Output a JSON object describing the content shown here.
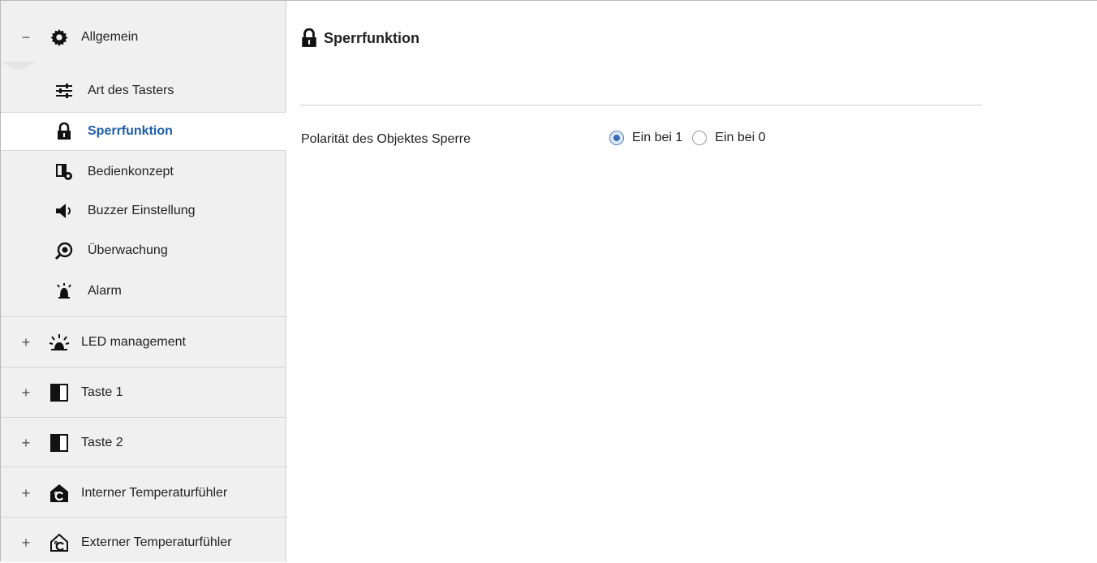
{
  "sidebar": {
    "groups": [
      {
        "toggle": "−",
        "icon": "gear-icon",
        "label": "Allgemein"
      },
      {
        "toggle": "+",
        "icon": "led-rays-icon",
        "label": "LED management"
      },
      {
        "toggle": "+",
        "icon": "half-square-icon",
        "label": "Taste 1"
      },
      {
        "toggle": "+",
        "icon": "half-square-icon",
        "label": "Taste 2"
      },
      {
        "toggle": "+",
        "icon": "house-thermometer-filled-icon",
        "label": "Interner Temperaturfühler"
      },
      {
        "toggle": "+",
        "icon": "house-thermometer-outline-icon",
        "label": "Externer Temperaturfühler"
      }
    ],
    "subitems": [
      {
        "icon": "sliders-icon",
        "label": "Art des Tasters"
      },
      {
        "icon": "lock-icon",
        "label": "Sperrfunktion",
        "active": true
      },
      {
        "icon": "panel-gear-icon",
        "label": "Bedienkonzept"
      },
      {
        "icon": "speaker-icon",
        "label": "Buzzer Einstellung"
      },
      {
        "icon": "eye-search-icon",
        "label": "Überwachung"
      },
      {
        "icon": "bell-rays-icon",
        "label": "Alarm"
      }
    ]
  },
  "main": {
    "title": "Sperrfunktion",
    "title_icon": "lock-icon",
    "param": {
      "label": "Polarität des Objektes Sperre",
      "options": [
        {
          "label": "Ein bei 1",
          "selected": true
        },
        {
          "label": "Ein bei 0",
          "selected": false
        }
      ]
    }
  },
  "colors": {
    "accent": "#1f5fa8",
    "sidebar_bg": "#f0f0f0",
    "radio_checked": "#3e6db5"
  }
}
